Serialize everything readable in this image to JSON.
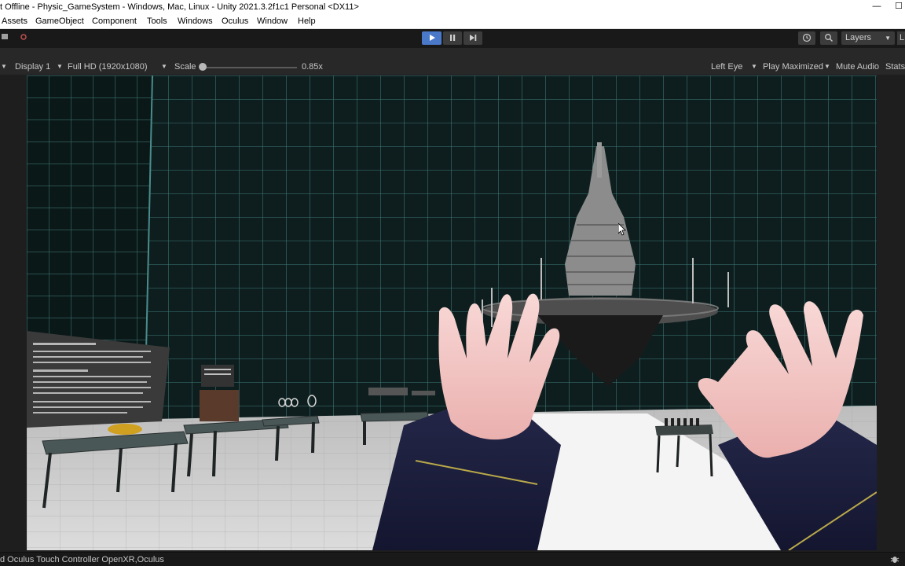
{
  "window": {
    "title": "t Offline - Physic_GameSystem - Windows, Mac, Linux - Unity 2021.3.2f1c1 Personal <DX11>",
    "minimize_icon": "minimize-icon",
    "maximize_icon": "maximize-icon"
  },
  "menu": {
    "items": [
      "Assets",
      "GameObject",
      "Component",
      "Tools",
      "Windows",
      "Oculus",
      "Window",
      "Help"
    ]
  },
  "toolbar": {
    "layers_label": "Layers",
    "right_cut_label": "L",
    "icons": {
      "left_1": "folder-icon",
      "left_2": "collab-icon",
      "play": "play-icon",
      "pause": "pause-icon",
      "step": "step-icon",
      "history": "history-icon",
      "search": "search-icon"
    },
    "colors": {
      "play_active": "#4b79c9"
    }
  },
  "game_view": {
    "display_label": "Display 1",
    "resolution_label": "Full HD (1920x1080)",
    "scale_label": "Scale",
    "scale_value": "0.85x",
    "eye_label": "Left Eye",
    "play_mode_label": "Play Maximized",
    "mute_label": "Mute Audio",
    "stats_label": "Stats"
  },
  "status_bar": {
    "message": "d Oculus Touch Controller OpenXR,Oculus",
    "icon": "bug-icon"
  }
}
